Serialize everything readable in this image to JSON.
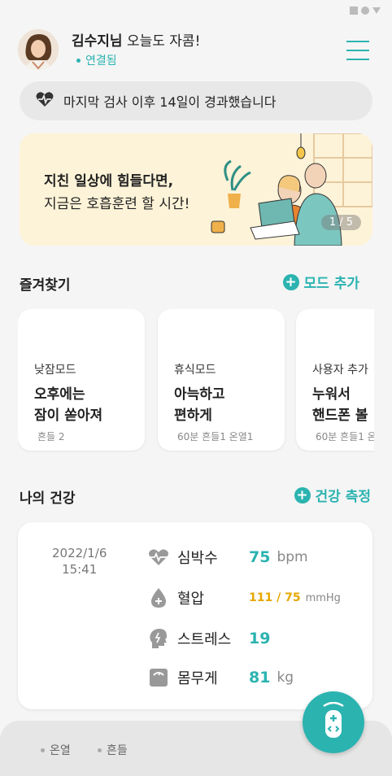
{
  "header": {
    "user_name": "김수지님",
    "greeting": " 오늘도 자콤!",
    "connection_status": "연결됨"
  },
  "notice": {
    "text": "마지막 검사 이후 14일이 경과했습니다"
  },
  "banner": {
    "line1": "지친 일상에 힘들다면,",
    "line2": "지금은 호흡훈련 할 시간!",
    "page_indicator": "1 / 5"
  },
  "favorites": {
    "title": "즐겨찾기",
    "add_label": "모드 추가",
    "cards": [
      {
        "mode": "낮잠모드",
        "title1": "오후에는",
        "title2": "잠이 쏟아져",
        "meta": "흔들 2"
      },
      {
        "mode": "휴식모드",
        "title1": "아늑하고",
        "title2": "편하게",
        "meta": "60분 흔들1 온열1"
      },
      {
        "mode": "사용자 추가",
        "title1": "누워서",
        "title2": "핸드폰 볼",
        "meta": "60분 흔들1 온"
      }
    ]
  },
  "health": {
    "title": "나의 건강",
    "measure_label": "건강 측정",
    "date": "2022/1/6",
    "time": "15:41",
    "rows": {
      "heart": {
        "label": "심박수",
        "value": "75",
        "unit": "bpm"
      },
      "bp": {
        "label": "혈압",
        "value": "111 / 75",
        "unit": "mmHg"
      },
      "stress": {
        "label": "스트레스",
        "value": "19"
      },
      "weight": {
        "label": "몸무게",
        "value": "81",
        "unit": "kg"
      }
    }
  },
  "bottom": {
    "chip1": "온열",
    "chip2": "흔들"
  },
  "colors": {
    "accent": "#2bb3b0",
    "bp": "#e6a700",
    "banner_bg": "#fdf3d8"
  },
  "icons": [
    "heart-icon",
    "water-drop-plus-icon",
    "head-stress-icon",
    "scale-icon",
    "remote-icon",
    "menu-icon"
  ]
}
